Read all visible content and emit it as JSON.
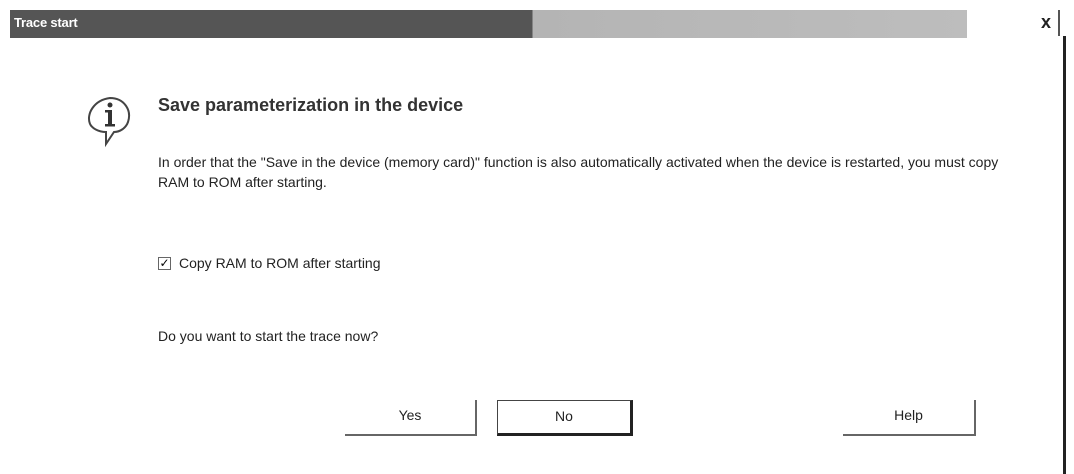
{
  "window": {
    "title": "Trace start",
    "close_label": "x"
  },
  "icons": {
    "info": "info-icon"
  },
  "content": {
    "heading": "Save parameterization in the device",
    "description": "In order that the \"Save in the device (memory card)\" function is also automatically activated when the device is restarted, you must copy RAM to ROM after starting.",
    "checkbox": {
      "label": "Copy RAM to ROM after starting",
      "checked": true,
      "check_glyph": "✓"
    },
    "question": "Do you want to start the trace now?"
  },
  "buttons": {
    "yes": "Yes",
    "no": "No",
    "help": "Help"
  },
  "colors": {
    "titlebar_active": "#555555",
    "titlebar_inactive": "#b4b4b4",
    "title_text": "#ffffff"
  }
}
